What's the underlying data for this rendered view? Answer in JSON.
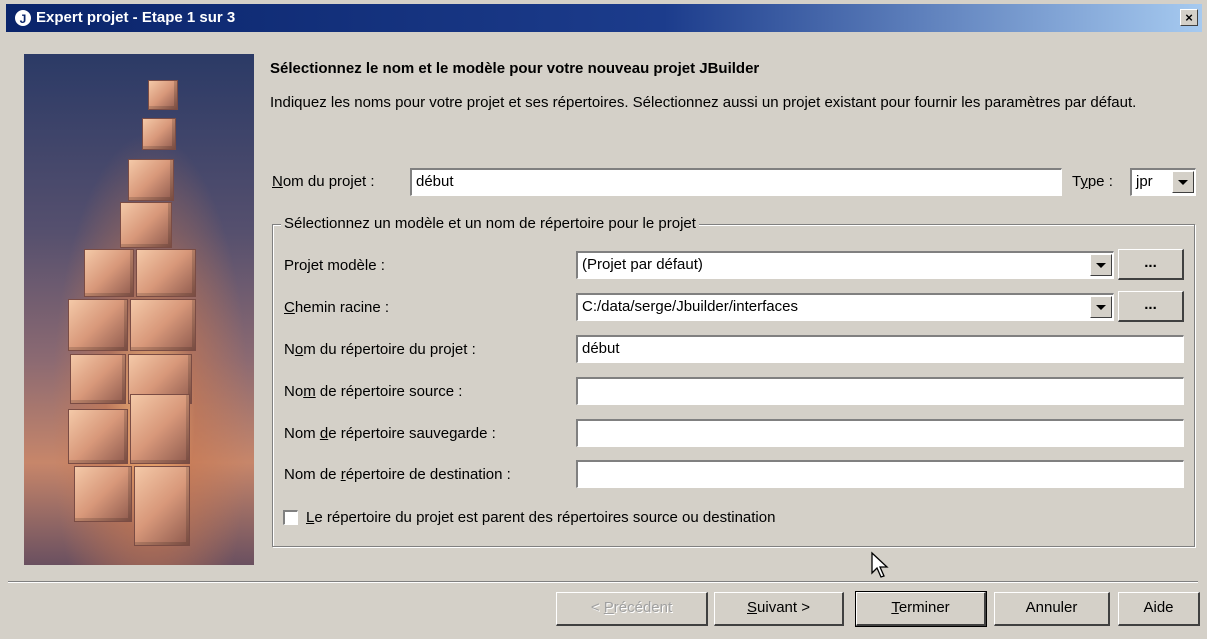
{
  "window": {
    "title": "Expert projet - Etape 1 sur 3",
    "icon": "jbuilder-j-icon",
    "close_icon": "close-icon",
    "close_label": "×"
  },
  "main": {
    "heading": "Sélectionnez le nom et le modèle pour votre nouveau projet JBuilder",
    "intro": "Indiquez les noms pour votre projet et ses répertoires. Sélectionnez aussi un projet existant pour fournir les paramètres par défaut."
  },
  "project": {
    "name_label_u": "N",
    "name_label_rest": "om du projet :",
    "name_value": "début",
    "type_label_pre": "T",
    "type_label_u": "y",
    "type_label_rest": "pe :",
    "type_value": "jpr"
  },
  "group": {
    "legend": "Sélectionnez un modèle et un nom de répertoire pour le projet",
    "template_label_pre": "Pro",
    "template_label_u": "j",
    "template_label_rest": "et modèle :",
    "template_value": "(Projet par défaut)",
    "root_label_u": "C",
    "root_label_rest": "hemin racine :",
    "root_value": "C:/data/serge/Jbuilder/interfaces",
    "browse_label": "...",
    "projdir_label_pre": "N",
    "projdir_label_u": "o",
    "projdir_label_rest": "m du répertoire du projet :",
    "projdir_value": "début",
    "srcdir_label_pre": "No",
    "srcdir_label_u": "m",
    "srcdir_label_rest": " de répertoire source :",
    "srcdir_value": "",
    "bakdir_label_pre": "Nom ",
    "bakdir_label_u": "d",
    "bakdir_label_rest": "e répertoire sauvegarde :",
    "bakdir_value": "",
    "outdir_label_pre": "Nom de ",
    "outdir_label_u": "r",
    "outdir_label_rest": "épertoire de destination :",
    "outdir_value": "",
    "checkbox_label_u": "L",
    "checkbox_label_rest": "e répertoire du projet est parent des répertoires source ou destination",
    "checkbox_checked": false
  },
  "buttons": {
    "previous_pre": "< ",
    "previous_u": "P",
    "previous_rest": "récédent",
    "next_u": "S",
    "next_rest": "uivant >",
    "finish_u": "T",
    "finish_rest": "erminer",
    "cancel": "Annuler",
    "help": "Aide"
  }
}
